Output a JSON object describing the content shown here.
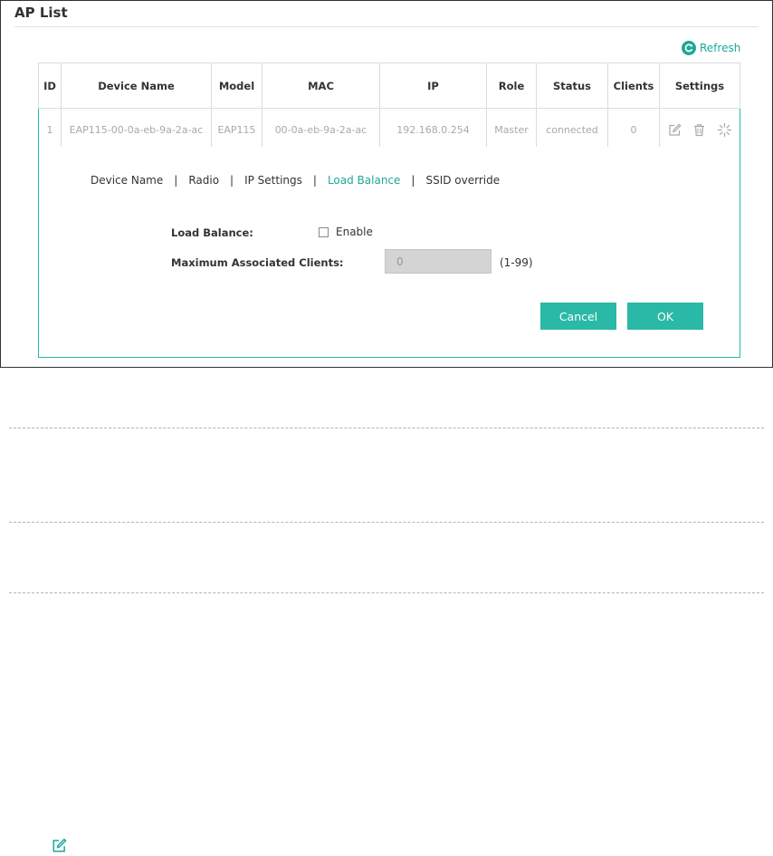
{
  "page": {
    "title": "AP List"
  },
  "toolbar": {
    "refresh_label": "Refresh",
    "refresh_icon": "refresh-icon"
  },
  "table": {
    "headers": [
      "ID",
      "Device Name",
      "Model",
      "MAC",
      "IP",
      "Role",
      "Status",
      "Clients",
      "Settings"
    ],
    "rows": [
      {
        "id": "1",
        "device_name": "EAP115-00-0a-eb-9a-2a-ac",
        "model": "EAP115",
        "mac": "00-0a-eb-9a-2a-ac",
        "ip": "192.168.0.254",
        "role": "Master",
        "status": "connected",
        "clients": "0",
        "actions": [
          "edit-icon",
          "delete-icon",
          "locate-icon"
        ]
      }
    ]
  },
  "detail": {
    "tabs": [
      {
        "label": "Device Name",
        "active": false
      },
      {
        "label": "Radio",
        "active": false
      },
      {
        "label": "IP Settings",
        "active": false
      },
      {
        "label": "Load Balance",
        "active": true
      },
      {
        "label": "SSID override",
        "active": false
      }
    ],
    "load_balance_label": "Load Balance:",
    "enable_label": "Enable",
    "enable_checked": false,
    "max_clients_label": "Maximum Associated Clients:",
    "max_clients_value": "0",
    "max_clients_range": "(1-99)",
    "cancel_label": "Cancel",
    "ok_label": "OK"
  },
  "colors": {
    "accent": "#2ab9a6",
    "accent_text": "#1ea79a",
    "disabled_input": "#d4d4d4"
  }
}
